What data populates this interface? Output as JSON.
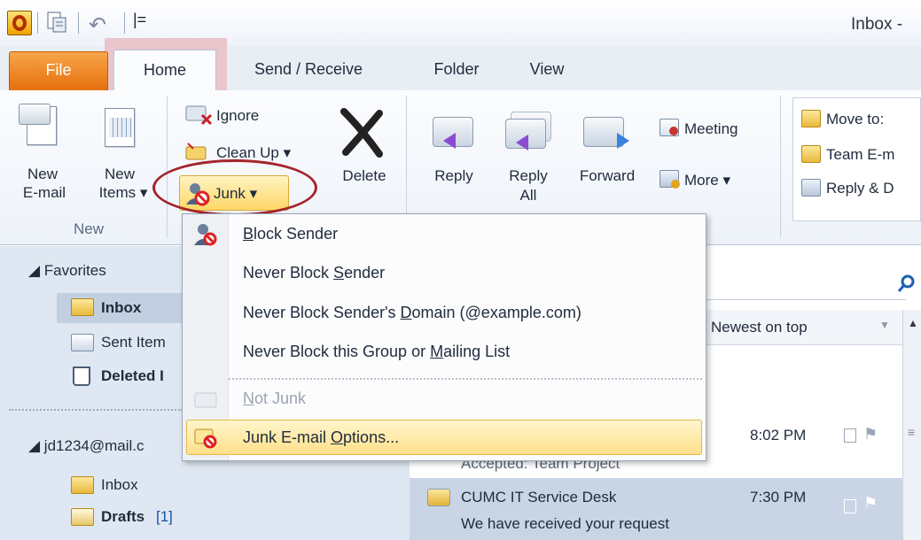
{
  "window": {
    "title": "Inbox -"
  },
  "quick_access": {
    "customize": "|="
  },
  "tabs": [
    {
      "label": "File"
    },
    {
      "label": "Home"
    },
    {
      "label": "Send / Receive"
    },
    {
      "label": "Folder"
    },
    {
      "label": "View"
    }
  ],
  "ribbon": {
    "new_group": {
      "new_email_1": "New",
      "new_email_2": "E-mail",
      "new_items_1": "New",
      "new_items_2": "Items ▾",
      "group_label": "New"
    },
    "delete_group": {
      "ignore": "Ignore",
      "clean_up": "Clean Up ▾",
      "junk": "Junk ▾",
      "delete": "Delete"
    },
    "respond_group": {
      "reply": "Reply",
      "reply_all_1": "Reply",
      "reply_all_2": "All",
      "forward": "Forward",
      "meeting": "Meeting",
      "more": "More ▾"
    },
    "quick_steps": {
      "move_to": "Move to:",
      "team_email": "Team E-m",
      "reply_delete": "Reply & D"
    }
  },
  "junk_menu": {
    "block_sender": {
      "pre": "",
      "accel": "B",
      "post": "lock Sender"
    },
    "never_block_sender": {
      "pre": "Never Block ",
      "accel": "S",
      "post": "ender"
    },
    "never_block_domain": {
      "pre": "Never Block Sender's ",
      "accel": "D",
      "post": "omain (@example.com)"
    },
    "never_block_group": {
      "pre": "Never Block this Group or ",
      "accel": "M",
      "post": "ailing List"
    },
    "not_junk": {
      "pre": "",
      "accel": "N",
      "post": "ot Junk"
    },
    "options": {
      "pre": "Junk E-mail ",
      "accel": "O",
      "post": "ptions..."
    }
  },
  "nav": {
    "favorites": "◢ Favorites",
    "inbox": "Inbox",
    "sent_items": "Sent Item",
    "deleted_items": "Deleted I",
    "account": "◢ jd1234@mail.c",
    "acct_inbox": "Inbox",
    "drafts": "Drafts",
    "drafts_count": "[1]"
  },
  "mail_list": {
    "arrange": "Newest on top",
    "row1": {
      "time": "8:02 PM",
      "subject": "Accepted: Team Project"
    },
    "row2": {
      "from": "CUMC IT Service Desk",
      "time": "7:30 PM",
      "subject": "We have received your request"
    }
  }
}
